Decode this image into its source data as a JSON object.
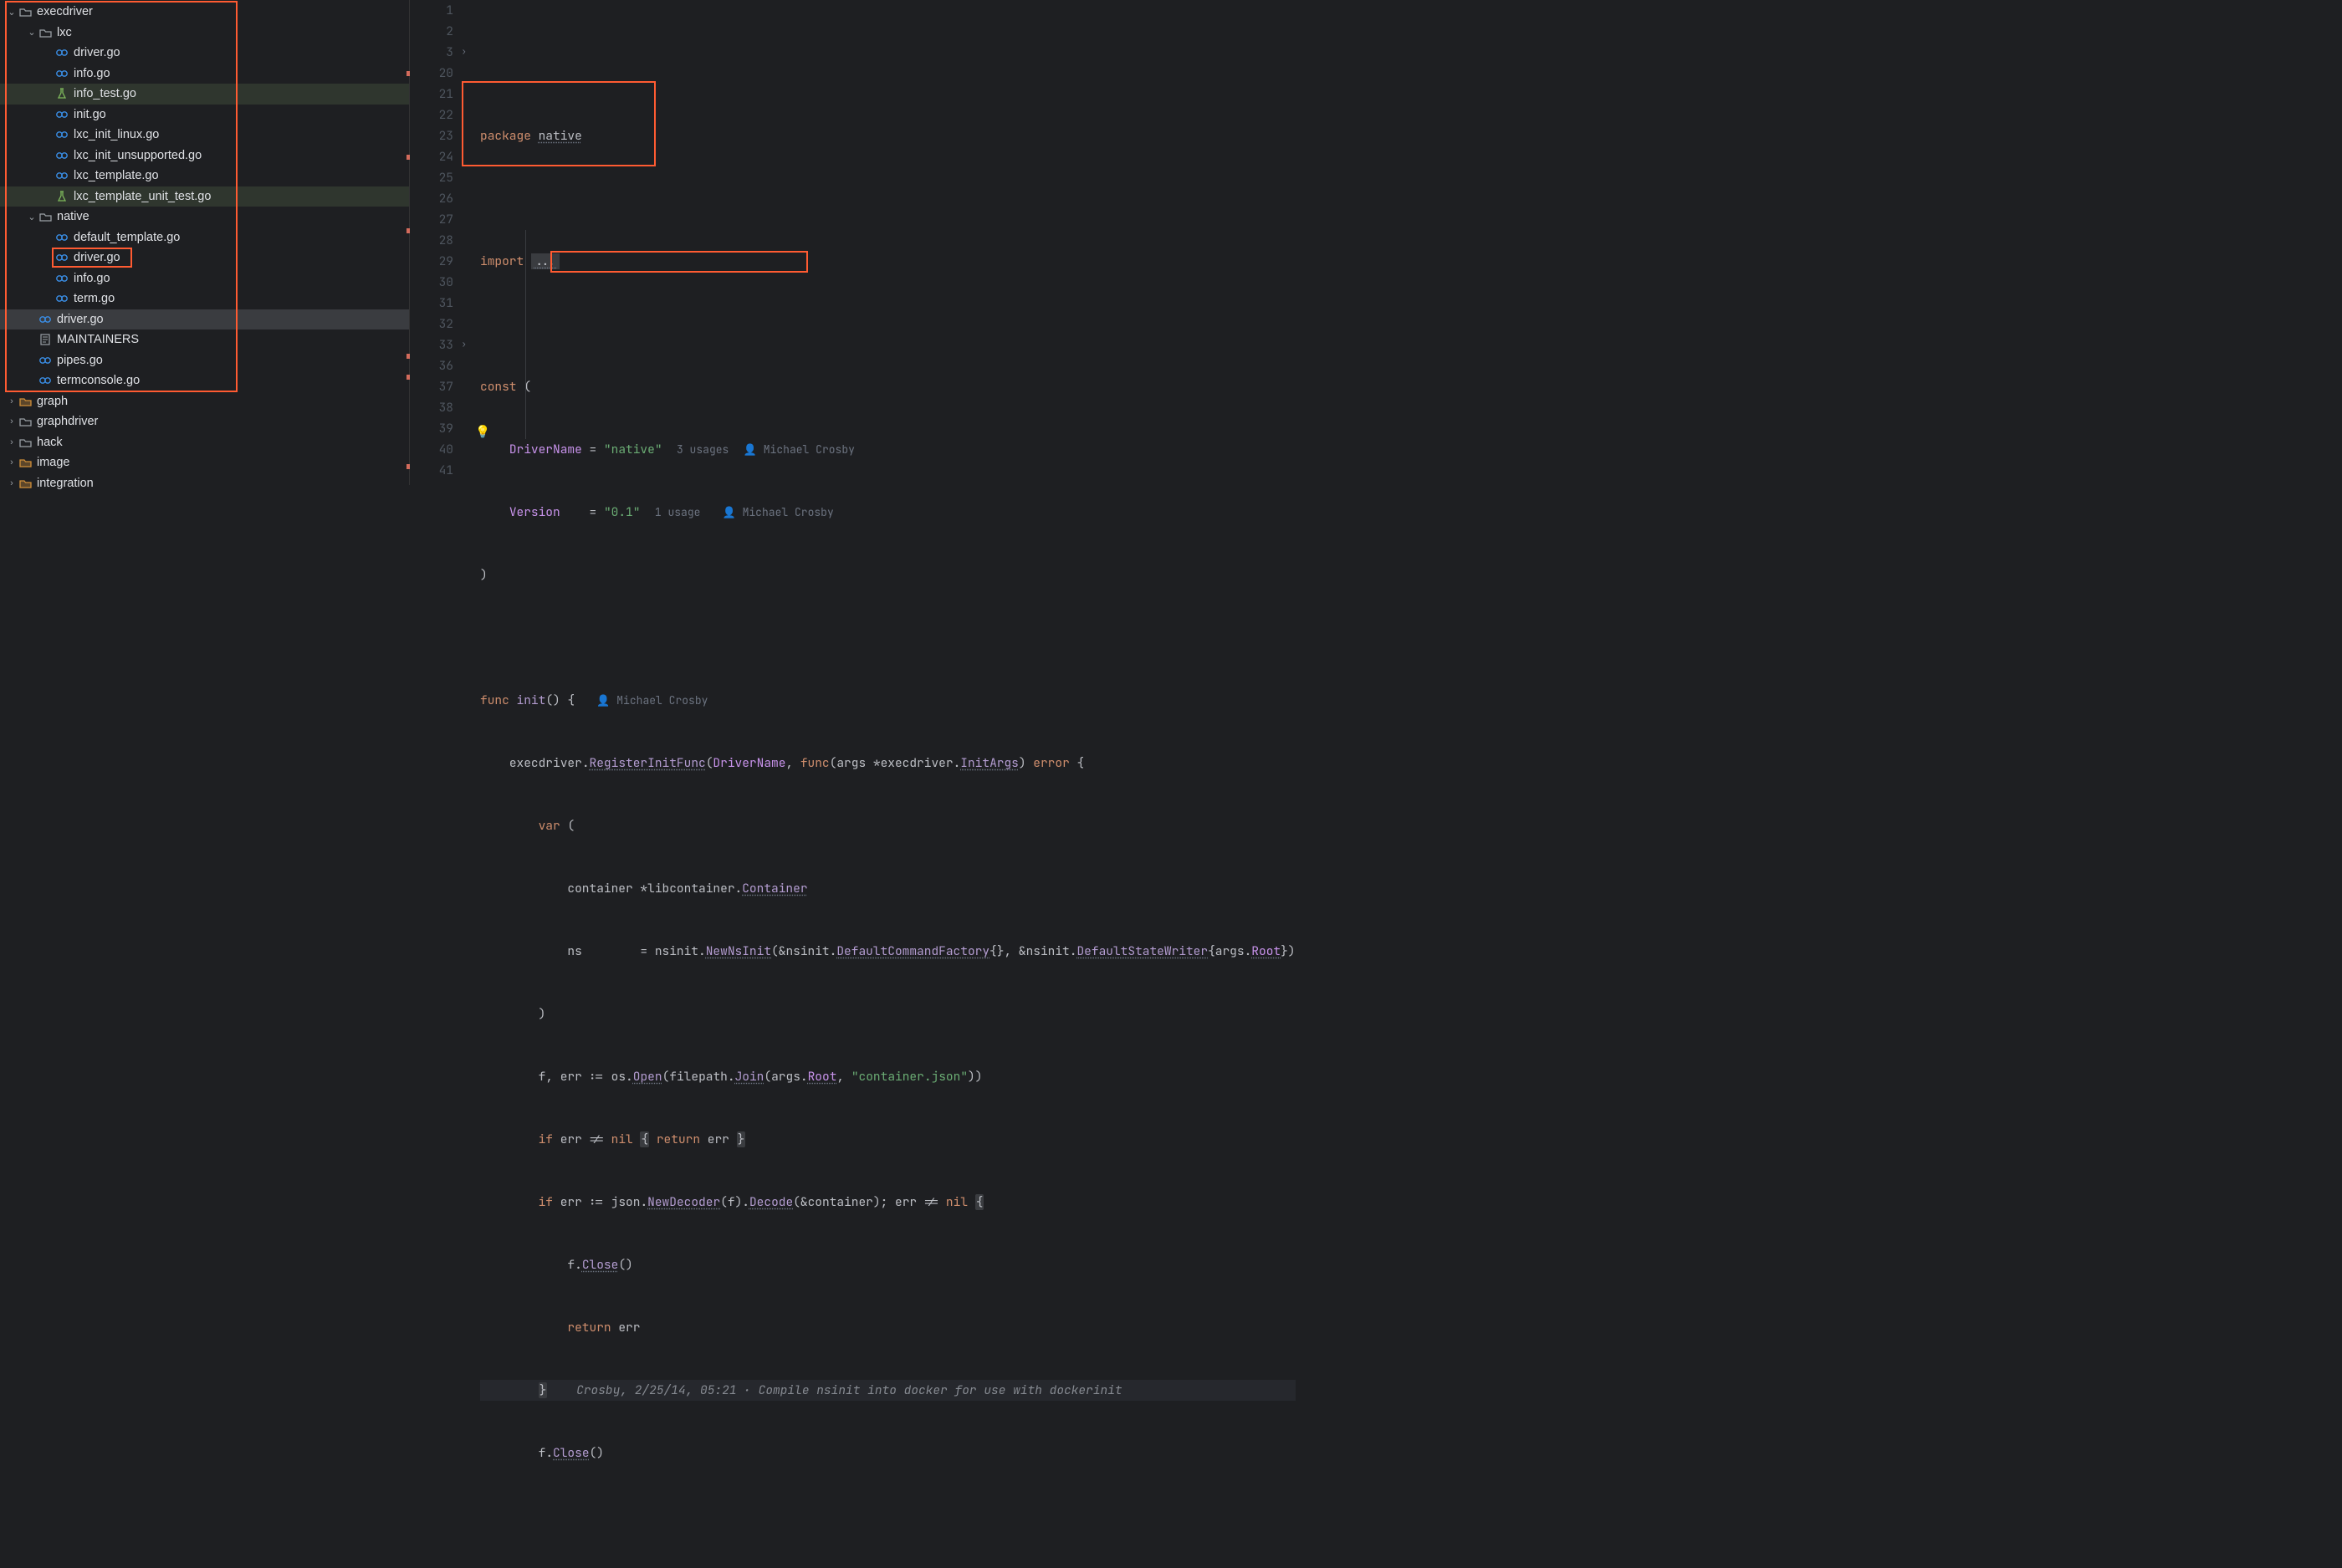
{
  "tree": {
    "execdriver": "execdriver",
    "lxc": "lxc",
    "lxc_files": [
      "driver.go",
      "info.go",
      "info_test.go",
      "init.go",
      "lxc_init_linux.go",
      "lxc_init_unsupported.go",
      "lxc_template.go",
      "lxc_template_unit_test.go"
    ],
    "native": "native",
    "native_files": [
      "default_template.go",
      "driver.go",
      "info.go",
      "term.go"
    ],
    "root_files": [
      "driver.go",
      "MAINTAINERS",
      "pipes.go",
      "termconsole.go"
    ],
    "graph": "graph",
    "graphdriver": "graphdriver",
    "hack": "hack",
    "image": "image",
    "integration": "integration"
  },
  "gutter": [
    "1",
    "2",
    "3",
    "20",
    "21",
    "22",
    "23",
    "24",
    "25",
    "26",
    "27",
    "28",
    "29",
    "30",
    "31",
    "32",
    "33",
    "36",
    "37",
    "38",
    "39",
    "40",
    "41"
  ],
  "code": {
    "package": "package",
    "native_pkg": "native",
    "import": "import",
    "import_dots": "...",
    "const": "const",
    "lparen": "(",
    "DriverName": "DriverName",
    "eq": "=",
    "str_native": "\"native\"",
    "u3": "3 usages",
    "mc": "Michael Crosby",
    "Version": "Version",
    "str_ver": "\"0.1\"",
    "u1": "1 usage",
    "rparen": ")",
    "func": "func",
    "init": "init",
    "empty_args": "()",
    "lbrace": "{",
    "execdriver": "execdriver",
    "dot": ".",
    "RegisterInitFunc": "RegisterInitFunc",
    "DriverName2": "DriverName",
    "func2": "func",
    "args": "args",
    "star": "*",
    "InitArgs": "InitArgs",
    "error": "error",
    "var": "var",
    "container": "container",
    "libcontainer": "libcontainer",
    "Container": "Container",
    "ns": "ns",
    "nsinit": "nsinit",
    "NewNsInit": "NewNsInit",
    "amp": "&",
    "DefaultCommandFactory": "DefaultCommandFactory",
    "braces": "{}",
    "DefaultStateWriter": "DefaultStateWriter",
    "Root": "Root",
    "f": "f",
    "err": "err",
    "coloneq": ":=",
    "os": "os",
    "Open": "Open",
    "filepath": "filepath",
    "Join": "Join",
    "containerjson": "\"container.json\"",
    "if": "if",
    "ne": "!=",
    "nil": "nil",
    "return": "return",
    "json": "json",
    "NewDecoder": "NewDecoder",
    "Decode": "Decode",
    "semi": ";",
    "Close": "Close",
    "comment": "Crosby, 2/25/14, 05:21 · Compile nsinit into docker for use with dockerinit"
  }
}
